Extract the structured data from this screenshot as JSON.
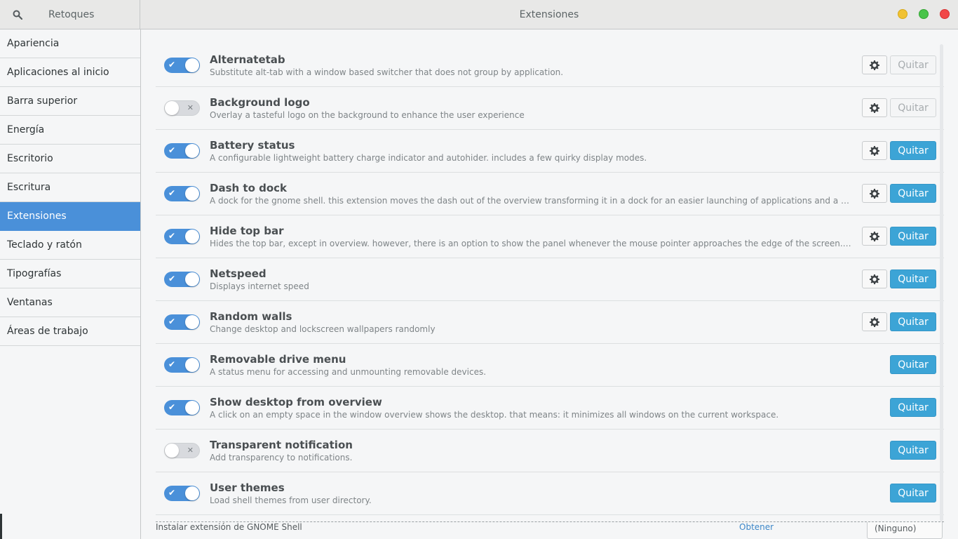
{
  "header": {
    "app_title": "Retoques",
    "page_title": "Extensiones",
    "search_icon": "search-icon"
  },
  "sidebar": {
    "items": [
      {
        "label": "Apariencia"
      },
      {
        "label": "Aplicaciones al inicio"
      },
      {
        "label": "Barra superior"
      },
      {
        "label": "Energía"
      },
      {
        "label": "Escritorio"
      },
      {
        "label": "Escritura"
      },
      {
        "label": "Extensiones",
        "selected": true
      },
      {
        "label": "Teclado y ratón"
      },
      {
        "label": "Tipografías"
      },
      {
        "label": "Ventanas"
      },
      {
        "label": "Áreas de trabajo"
      }
    ]
  },
  "extensions": [
    {
      "name": "Alternatetab",
      "description": "Substitute alt-tab with a window based switcher that does not group by application.",
      "enabled": true,
      "has_settings": true,
      "remove_label": "Quitar",
      "remove_enabled": false
    },
    {
      "name": "Background logo",
      "description": "Overlay a tasteful logo on the background to enhance the user experience",
      "enabled": false,
      "has_settings": true,
      "remove_label": "Quitar",
      "remove_enabled": false
    },
    {
      "name": "Battery status",
      "description": "A configurable lightweight battery charge indicator and autohider. includes a few quirky display modes.",
      "enabled": true,
      "has_settings": true,
      "remove_label": "Quitar",
      "remove_enabled": true
    },
    {
      "name": "Dash to dock",
      "description": "A dock for the gnome shell. this extension moves the dash out of the overview transforming it in a dock for an easier launching of applications and a faster switching bet...",
      "enabled": true,
      "has_settings": true,
      "remove_label": "Quitar",
      "remove_enabled": true
    },
    {
      "name": "Hide top bar",
      "description": "Hides the top bar, except in overview. however, there is an option to show the panel whenever the mouse pointer approaches the edge of the screen. and if \"intellihide\" is...",
      "enabled": true,
      "has_settings": true,
      "remove_label": "Quitar",
      "remove_enabled": true
    },
    {
      "name": "Netspeed",
      "description": "Displays internet speed",
      "enabled": true,
      "has_settings": true,
      "remove_label": "Quitar",
      "remove_enabled": true
    },
    {
      "name": "Random walls",
      "description": "Change desktop and lockscreen wallpapers randomly",
      "enabled": true,
      "has_settings": true,
      "remove_label": "Quitar",
      "remove_enabled": true
    },
    {
      "name": "Removable drive menu",
      "description": "A status menu for accessing and unmounting removable devices.",
      "enabled": true,
      "has_settings": false,
      "remove_label": "Quitar",
      "remove_enabled": true
    },
    {
      "name": "Show desktop from overview",
      "description": "A click on an empty space in the window overview shows the desktop. that means: it minimizes all windows on the current workspace.",
      "enabled": true,
      "has_settings": false,
      "remove_label": "Quitar",
      "remove_enabled": true
    },
    {
      "name": "Transparent notification",
      "description": "Add transparency to notifications.",
      "enabled": false,
      "has_settings": false,
      "remove_label": "Quitar",
      "remove_enabled": true
    },
    {
      "name": "User themes",
      "description": "Load shell themes from user directory.",
      "enabled": true,
      "has_settings": false,
      "remove_label": "Quitar",
      "remove_enabled": true
    }
  ],
  "footer": {
    "text": "Instalar extensión de GNOME Shell",
    "link": "Obtener",
    "combo_value": "(Ninguno)"
  },
  "colors": {
    "accent": "#4a90d9",
    "button_blue": "#3ca4d6",
    "wm_minimize": "#f1c232",
    "wm_maximize": "#49c44a",
    "wm_close": "#f14848"
  }
}
